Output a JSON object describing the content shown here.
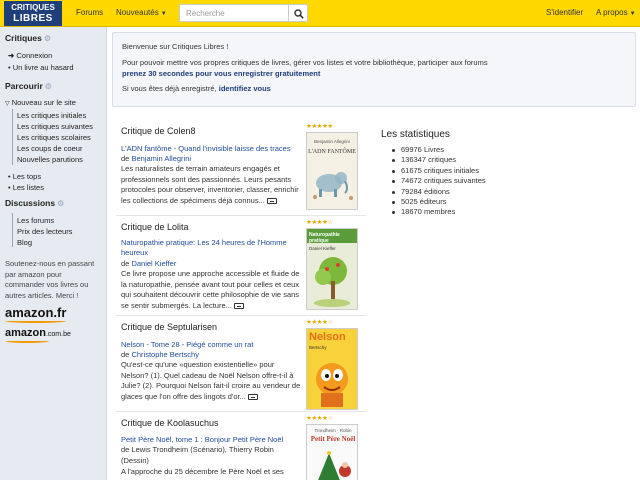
{
  "logo": {
    "line1": "CRITIQUES",
    "line2": "LIBRES"
  },
  "nav": {
    "forums": "Forums",
    "nouveautes": "Nouveautés",
    "identifier": "S'identifier",
    "apropos": "A propos"
  },
  "search": {
    "placeholder": "Recherche"
  },
  "sidebar": {
    "critiques_title": "Critiques",
    "connexion": "Connexion",
    "hasard": "Un livre au hasard",
    "parcourir_title": "Parcourir",
    "nouveau": "Nouveau sur le site",
    "sub": [
      "Les critiques initiales",
      "Les critiques suivantes",
      "Les critiques scolaires",
      "Les coups de coeur",
      "Nouvelles parutions"
    ],
    "tops": "Les tops",
    "listes": "Les listes",
    "discussions_title": "Discussions",
    "disc": [
      "Les forums",
      "Prix des lecteurs",
      "Blog"
    ],
    "support_text": "Soutenez-nous en passant par amazon pour commander vos livres ou autres articles. Merci !",
    "amazon_fr": "amazon.fr",
    "amazon_be": "amazon",
    "amazon_be_suffix": ".com.be"
  },
  "welcome": {
    "line1": "Bienvenue sur Critiques Libres !",
    "line2": "Pour pouvoir mettre vos propres critiques de livres, gérer vos listes et votre bibliothèque, participer aux forums",
    "line3": "prenez 30 secondes pour vous enregistrer gratuitement",
    "line4a": "Si vous êtes déjà enregistré,",
    "line4b": "identifiez vous"
  },
  "reviews": [
    {
      "head": "Critique de Colen8",
      "title": "L'ADN fantôme - Quand l'invisible laisse des traces",
      "by": "de",
      "author": "Benjamin Allegrini",
      "body": "Les naturalistes de terrain amateurs engagés et professionnels sont des passionnés. Leurs pesants protocoles pour observer, inventorier, classer, enrichir les collections de spécimens déjà connus...",
      "stars": "★★★★★",
      "cover_title": "L'ADN FANTÔME",
      "cover_author": "Benjamin Allegrini"
    },
    {
      "head": "Critique de Lolita",
      "title": "Naturopathie pratique: Les 24 heures de l'Homme heureux",
      "by": "de",
      "author": "Daniel Kieffer",
      "body": "Ce livre propose une approche accessible et fluide de la naturopathie, pensée avant tout pour celles et ceux qui souhaitent découvrir cette philosophie de vie sans se sentir submergés. La lecture...",
      "stars": "★★★★☆",
      "cover_title": "Naturopathie pratique",
      "cover_author": "Daniel Kieffer"
    },
    {
      "head": "Critique de Septularisen",
      "title": "Nelson - Tome 28 - Piégé comme un rat",
      "by": "de",
      "author": "Christophe Bertschy",
      "body": "Qu'est-ce qu'une «question existentielle» pour Nelson? (1). Quel cadeau de Noël Nelson offre-t-il à Julie? (2). Pourquoi Nelson fait-il croire au vendeur de glaces que l'on offre des lingots d'or...",
      "stars": "★★★★☆",
      "cover_title": "Nelson",
      "cover_author": "Bertschy"
    },
    {
      "head": "Critique de Koolasuchus",
      "title": "Petit Père Noël, tome 1 : Bonjour Petit Père Noël",
      "by": "de",
      "author": "Lewis Trondheim (Scénario), Thierry Robin (Dessin)",
      "body": "A l'approche du 25 décembre le Père Noël et ses",
      "stars": "★★★★☆",
      "cover_title": "Petit Père Noël",
      "cover_author": "Trondheim · Robin"
    }
  ],
  "stats": {
    "title": "Les statistiques",
    "items": [
      "69976 Livres",
      "136347 critiques",
      "61675 critiques initiales",
      "74672 critiques suivantes",
      "79284 éditions",
      "5025 éditeurs",
      "18670 membres"
    ]
  },
  "colors": {
    "accent": "#ffd800",
    "link": "#1f4c9a",
    "brand": "#1f3f7a",
    "sidebar_bg": "#e6ebf1"
  }
}
